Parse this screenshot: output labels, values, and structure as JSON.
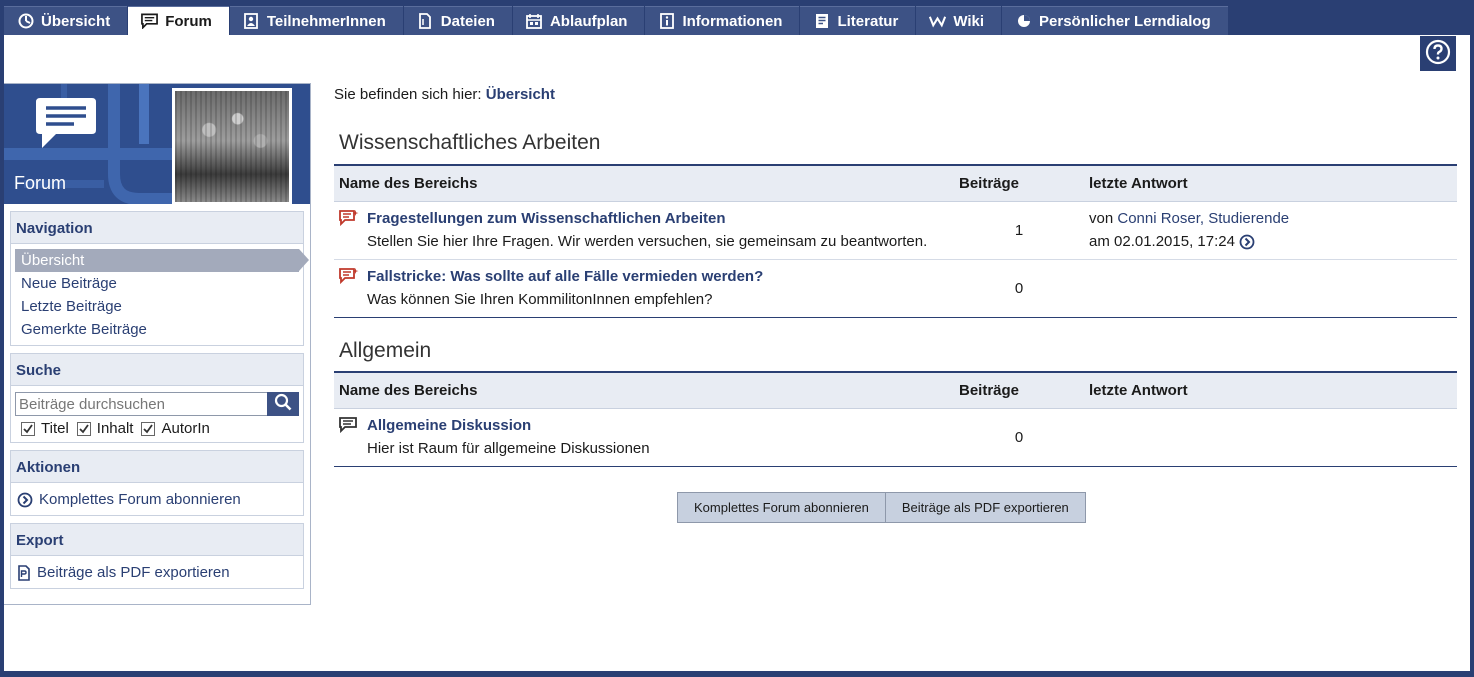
{
  "tabs": [
    {
      "label": "Übersicht",
      "icon": "overview-icon",
      "active": false
    },
    {
      "label": "Forum",
      "icon": "forum-icon",
      "active": true
    },
    {
      "label": "TeilnehmerInnen",
      "icon": "participants-icon",
      "active": false
    },
    {
      "label": "Dateien",
      "icon": "files-icon",
      "active": false
    },
    {
      "label": "Ablaufplan",
      "icon": "schedule-icon",
      "active": false
    },
    {
      "label": "Informationen",
      "icon": "info-icon",
      "active": false
    },
    {
      "label": "Literatur",
      "icon": "literature-icon",
      "active": false
    },
    {
      "label": "Wiki",
      "icon": "wiki-icon",
      "active": false
    },
    {
      "label": "Persönlicher Lerndialog",
      "icon": "learning-dialog-icon",
      "active": false
    }
  ],
  "help_icon": "help-icon",
  "sidebar": {
    "header_title": "Forum",
    "navigation": {
      "title": "Navigation",
      "items": [
        "Übersicht",
        "Neue Beiträge",
        "Letzte Beiträge",
        "Gemerkte Beiträge"
      ],
      "active_index": 0
    },
    "search": {
      "title": "Suche",
      "placeholder": "Beiträge durchsuchen",
      "options": [
        {
          "label": "Titel",
          "checked": true
        },
        {
          "label": "Inhalt",
          "checked": true
        },
        {
          "label": "AutorIn",
          "checked": true
        }
      ]
    },
    "actions": {
      "title": "Aktionen",
      "item": "Komplettes Forum abonnieren"
    },
    "export": {
      "title": "Export",
      "item": "Beiträge als PDF exportieren"
    }
  },
  "breadcrumb": {
    "prefix": "Sie befinden sich hier:",
    "current": "Übersicht"
  },
  "columns": {
    "name": "Name des Bereichs",
    "count": "Beiträge",
    "last": "letzte Antwort"
  },
  "categories": [
    {
      "title": "Wissenschaftliches Arbeiten",
      "areas": [
        {
          "title": "Fragestellungen zum Wissenschaftlichen Arbeiten",
          "description": "Stellen Sie hier Ihre Fragen. Wir werden versuchen, sie gemeinsam zu beantworten.",
          "count": "1",
          "last_prefix": "von",
          "last_author": "Conni Roser, Studierende",
          "last_date": "am 02.01.2015, 17:24",
          "icon": "new-posts-icon"
        },
        {
          "title": "Fallstricke: Was sollte auf alle Fälle vermieden werden?",
          "description": "Was können Sie Ihren KommilitonInnen empfehlen?",
          "count": "0",
          "icon": "new-posts-icon"
        }
      ]
    },
    {
      "title": "Allgemein",
      "areas": [
        {
          "title": "Allgemeine Diskussion",
          "description": "Hier ist Raum für allgemeine Diskussionen",
          "count": "0",
          "icon": "discussion-icon"
        }
      ]
    }
  ],
  "buttons": {
    "subscribe": "Komplettes Forum abonnieren",
    "export_pdf": "Beiträge als PDF exportieren"
  },
  "colors": {
    "brand": "#2a3f73",
    "accent_red": "#c0392b"
  }
}
